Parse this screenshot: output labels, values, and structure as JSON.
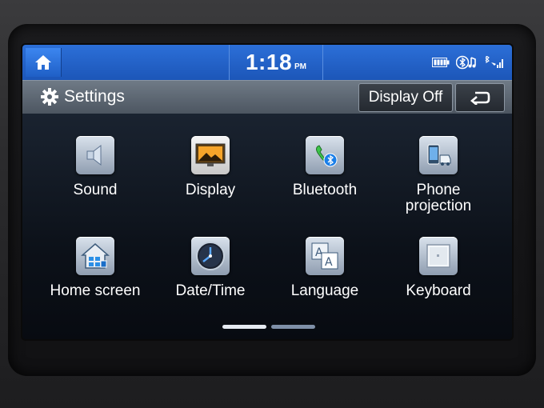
{
  "status": {
    "time": "1:18",
    "ampm": "PM"
  },
  "title_bar": {
    "title": "Settings",
    "display_off_label": "Display Off"
  },
  "items": [
    {
      "label": "Sound",
      "icon": "speaker-icon"
    },
    {
      "label": "Display",
      "icon": "display-icon"
    },
    {
      "label": "Bluetooth",
      "icon": "bluetooth-icon"
    },
    {
      "label": "Phone\nprojection",
      "icon": "phone-projection-icon"
    },
    {
      "label": "Home screen",
      "icon": "home-screen-icon"
    },
    {
      "label": "Date/Time",
      "icon": "clock-icon"
    },
    {
      "label": "Language",
      "icon": "language-icon"
    },
    {
      "label": "Keyboard",
      "icon": "keyboard-icon"
    }
  ],
  "pagination": {
    "current_page": 1,
    "total_pages": 2
  },
  "colors": {
    "status_bar": "#1c56b8",
    "title_bar": "#5a6470",
    "background": "#0c1119"
  }
}
